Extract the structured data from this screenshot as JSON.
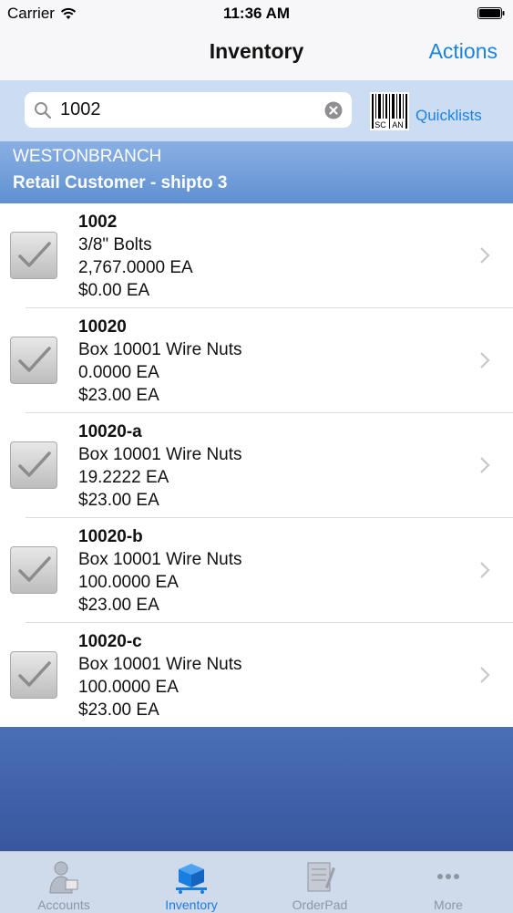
{
  "status_bar": {
    "carrier": "Carrier",
    "time": "11:36 AM"
  },
  "navbar": {
    "title": "Inventory",
    "action_label": "Actions"
  },
  "search": {
    "value": "1002",
    "quicklists_label": "Quicklists",
    "scan_label_top": "SC",
    "scan_label_bottom": "AN"
  },
  "branch": {
    "name": "WESTONBRANCH",
    "customer": "Retail Customer - shipto 3"
  },
  "items": [
    {
      "code": "1002",
      "description": "3/8\" Bolts",
      "quantity": "2,767.0000 EA",
      "price": "$0.00 EA"
    },
    {
      "code": "10020",
      "description": "Box 10001 Wire Nuts",
      "quantity": "0.0000 EA",
      "price": "$23.00 EA"
    },
    {
      "code": "10020-a",
      "description": "Box 10001 Wire Nuts",
      "quantity": "19.2222 EA",
      "price": "$23.00 EA"
    },
    {
      "code": "10020-b",
      "description": "Box 10001 Wire Nuts",
      "quantity": "100.0000 EA",
      "price": "$23.00 EA"
    },
    {
      "code": "10020-c",
      "description": "Box 10001 Wire Nuts",
      "quantity": "100.0000 EA",
      "price": "$23.00 EA"
    }
  ],
  "tabs": [
    {
      "label": "Accounts",
      "icon": "accounts-icon",
      "active": false
    },
    {
      "label": "Inventory",
      "icon": "inventory-icon",
      "active": true
    },
    {
      "label": "OrderPad",
      "icon": "orderpad-icon",
      "active": false
    },
    {
      "label": "More",
      "icon": "more-icon",
      "active": false
    }
  ],
  "colors": {
    "accent": "#1a82e0",
    "branch_band": "#6f9bd9",
    "footer_band": "#3d5ea6",
    "tabbar": "#cfdaea"
  }
}
